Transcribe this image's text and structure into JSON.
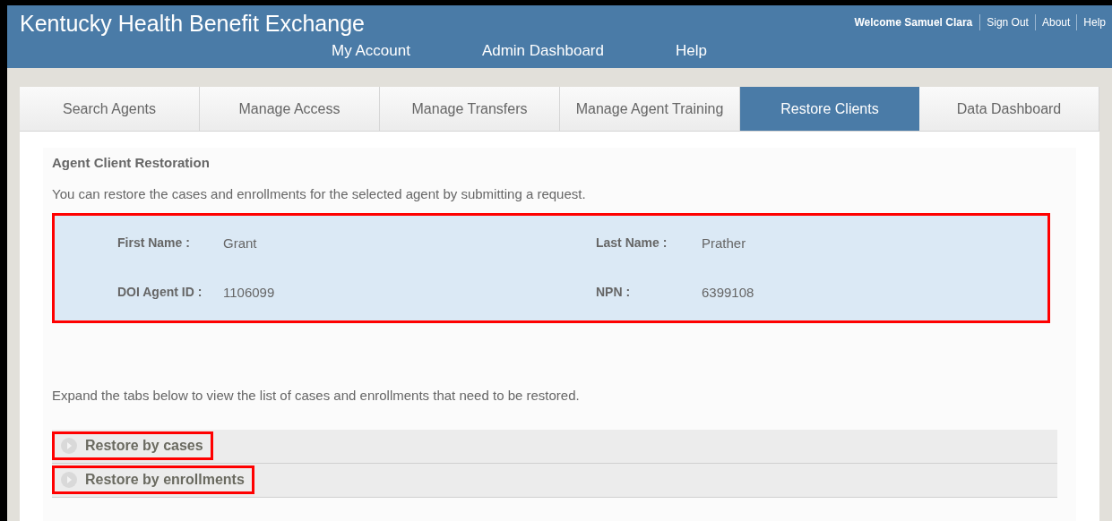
{
  "header": {
    "title": "Kentucky Health Benefit Exchange",
    "nav": [
      "My Account",
      "Admin Dashboard",
      "Help"
    ],
    "welcome": "Welcome Samuel Clara",
    "links": [
      "Sign Out",
      "About",
      "Help"
    ]
  },
  "tabs": [
    {
      "label": "Search Agents",
      "selected": false
    },
    {
      "label": "Manage Access",
      "selected": false
    },
    {
      "label": "Manage Transfers",
      "selected": false
    },
    {
      "label": "Manage Agent Training",
      "selected": false
    },
    {
      "label": "Restore Clients",
      "selected": true
    },
    {
      "label": "Data Dashboard",
      "selected": false
    }
  ],
  "section": {
    "title": "Agent Client Restoration",
    "description": "You can restore the cases and enrollments for the selected agent by submitting a request."
  },
  "agent_info": {
    "highlighted": true,
    "fields": [
      {
        "label": "First Name :",
        "value": "Grant"
      },
      {
        "label": "Last Name :",
        "value": "Prather"
      },
      {
        "label": "DOI Agent ID :",
        "value": "1106099"
      },
      {
        "label": "NPN :",
        "value": "6399108"
      }
    ]
  },
  "instructions": "Expand the tabs below to view the list of cases and enrollments that need to be restored.",
  "accordions": [
    {
      "label": "Restore by cases",
      "expanded": false,
      "highlighted": true
    },
    {
      "label": "Restore by enrollments",
      "expanded": false,
      "highlighted": true
    }
  ]
}
